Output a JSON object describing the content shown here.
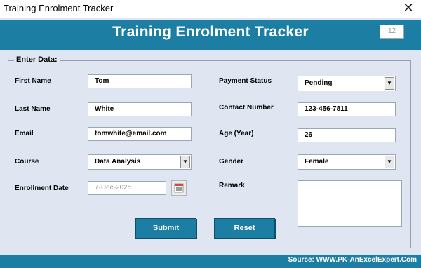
{
  "window": {
    "title": "Training Enrolment Tracker"
  },
  "header": {
    "title": "Training Enrolment Tracker",
    "record_number": "12"
  },
  "frame": {
    "legend": "Enter Data:"
  },
  "left": {
    "first_name": {
      "label": "First Name",
      "value": "Tom"
    },
    "last_name": {
      "label": "Last Name",
      "value": "White"
    },
    "email": {
      "label": "Email",
      "value": "tomwhite@email.com"
    },
    "course": {
      "label": "Course",
      "value": "Data Analysis"
    },
    "enrollment_date": {
      "label": "Enrollment Date",
      "value": "7-Dec-2025"
    }
  },
  "right": {
    "payment_status": {
      "label": "Payment Status",
      "value": "Pending"
    },
    "contact_number": {
      "label": "Contact Number",
      "value": "123-456-7811"
    },
    "age": {
      "label": "Age (Year)",
      "value": "26"
    },
    "gender": {
      "label": "Gender",
      "value": "Female"
    },
    "remark": {
      "label": "Remark",
      "value": ""
    }
  },
  "buttons": {
    "submit": "Submit",
    "reset": "Reset"
  },
  "footer": {
    "source": "Source: WWW.PK-AnExcelExpert.Com"
  },
  "icons": {
    "close": "close-icon",
    "calendar": "calendar-icon",
    "dropdown": "chevron-down-icon"
  },
  "colors": {
    "accent": "#1d7ea3",
    "form_background": "#dfe6f2"
  }
}
